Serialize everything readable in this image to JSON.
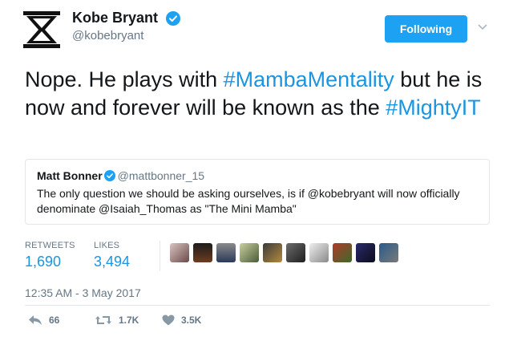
{
  "author": {
    "name": "Kobe Bryant",
    "handle": "@kobebryant",
    "avatar_icon": "hourglass-logo-icon",
    "verified_icon": "verified-badge-icon"
  },
  "follow_button": {
    "label": "Following",
    "color": "#1da1f2"
  },
  "tweet": {
    "text_before": "Nope. He plays with ",
    "hashtag1": "#MambaMentality",
    "text_middle": " but he is now and forever will be known as the ",
    "hashtag2": "#MightyIT"
  },
  "quoted_tweet": {
    "name": "Matt Bonner",
    "handle": "@mattbonner_15",
    "text": "The only question we should be asking ourselves, is if @kobebryant will now officially denominate @Isaiah_Thomas as \"The Mini Mamba\""
  },
  "stats": {
    "retweets_label": "RETWEETS",
    "retweets_value": "1,690",
    "likes_label": "LIKES",
    "likes_value": "3,494"
  },
  "likers_avatars": [
    "liker-avatar",
    "liker-avatar",
    "liker-avatar",
    "liker-avatar",
    "liker-avatar",
    "liker-avatar",
    "liker-avatar",
    "liker-avatar",
    "liker-avatar",
    "liker-avatar"
  ],
  "timestamp": "12:35 AM - 3 May 2017",
  "actions": {
    "reply_count": "66",
    "retweet_count": "1.7K",
    "like_count": "3.5K"
  },
  "colors": {
    "link": "#1b95e0",
    "secondary_text": "#657786",
    "border": "#e1e8ed"
  }
}
